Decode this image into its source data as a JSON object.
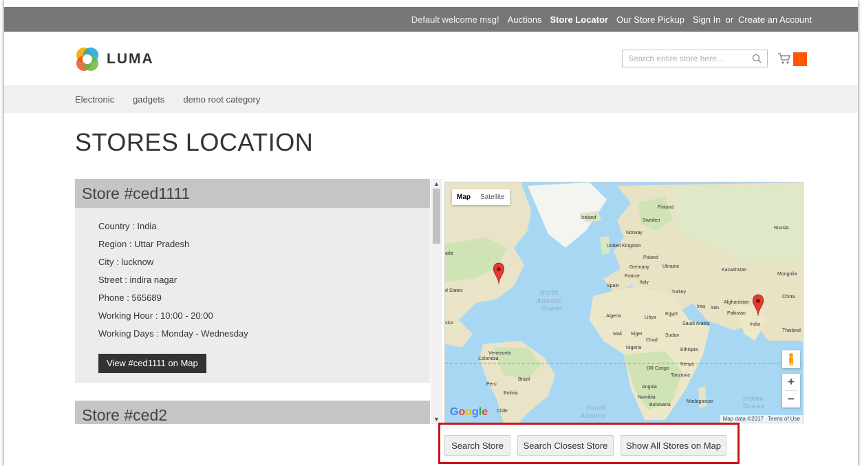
{
  "topbar": {
    "welcome": "Default welcome msg!",
    "links": [
      "Auctions",
      "Store Locator",
      "Our Store Pickup",
      "Sign In",
      "or",
      "Create an Account"
    ],
    "active": "Store Locator"
  },
  "header": {
    "logo_text": "LUMA",
    "search_placeholder": "Search entire store here...",
    "cart_icon": "cart-icon",
    "accent": "#ff5501"
  },
  "nav": {
    "items": [
      "Electronic",
      "gadgets",
      "demo root category"
    ]
  },
  "page": {
    "title": "STORES LOCATION"
  },
  "stores": [
    {
      "name": "Store #ced1111",
      "rows": [
        "Country : India",
        "Region : Uttar Pradesh",
        "City : lucknow",
        "Street : indira nagar",
        "Phone : 565689",
        "Working Hour : 10:00 - 20:00",
        "Working Days : Monday - Wednesday"
      ],
      "button": "View #ced1111 on Map"
    },
    {
      "name": "Store #ced2"
    }
  ],
  "map": {
    "type_map": "Map",
    "type_satellite": "Satellite",
    "zoom_in": "+",
    "zoom_out": "−",
    "google": "Google",
    "attribution": "Map data ©2017",
    "terms": "Terms of Use",
    "labels": {
      "finland": "Finland",
      "sweden": "Sweden",
      "iceland": "Iceland",
      "norway": "Norway",
      "russia": "Russia",
      "uk": "United Kingdom",
      "poland": "Poland",
      "germany": "Germany",
      "ukraine": "Ukraine",
      "france": "France",
      "kazakhstan": "Kazakhstan",
      "mongolia": "Mongolia",
      "spain": "Spain",
      "italy": "Italy",
      "turkey": "Turkey",
      "iraq": "Iraq",
      "iran": "Iran",
      "afghanistan": "Afghanistan",
      "pakistan": "Pakistan",
      "china": "China",
      "india": "India",
      "thailand": "Thailand",
      "algeria": "Algeria",
      "libya": "Libya",
      "egypt": "Egypt",
      "saudi": "Saudi Arabia",
      "mali": "Mali",
      "niger": "Niger",
      "chad": "Chad",
      "sudan": "Sudan",
      "nigeria": "Nigeria",
      "ethiopia": "Ethiopia",
      "kenya": "Kenya",
      "drcongo": "DR Congo",
      "tanzania": "Tanzania",
      "angola": "Angola",
      "namibia": "Namibia",
      "botswana": "Botswana",
      "madagascar": "Madagascar",
      "venezuela": "Venezuela",
      "colombia": "Colombia",
      "brazil": "Brazil",
      "peru": "Peru",
      "bolivia": "Bolivia",
      "chile": "Chile",
      "states": "d States",
      "ada": "ada",
      "xico": "xico",
      "north_atlantic": "North",
      "atlantic": "Atlantic",
      "ocean": "Ocean",
      "south": "South",
      "south_atlantic": "Atlantic",
      "indian": "Indian",
      "indian_ocean": "Ocean"
    }
  },
  "actions": {
    "search_store": "Search Store",
    "search_closest": "Search Closest Store",
    "show_all": "Show All Stores on Map",
    "highlight": "#cc1419"
  }
}
